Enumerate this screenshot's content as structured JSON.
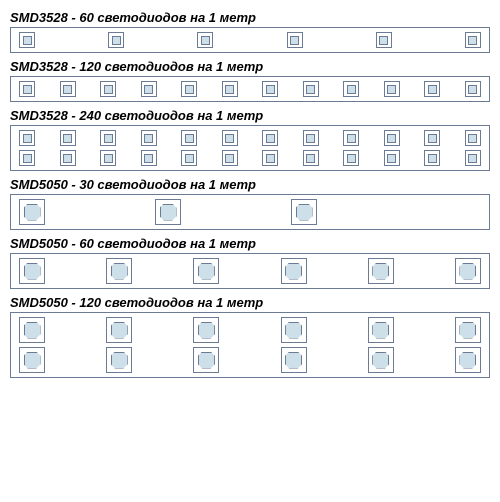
{
  "sections": [
    {
      "label": "SMD3528 - 60 светодиодов на 1 метр",
      "rows": 1,
      "perRow": 6,
      "size": "small",
      "layout": "spread"
    },
    {
      "label": "SMD3528 - 120 светодиодов на 1 метр",
      "rows": 1,
      "perRow": 12,
      "size": "small",
      "layout": "spread"
    },
    {
      "label": "SMD3528 - 240 светодиодов на 1 метр",
      "rows": 2,
      "perRow": 12,
      "size": "small",
      "layout": "spread"
    },
    {
      "label": "SMD5050 - 30 светодиодов на 1 метр",
      "rows": 1,
      "perRow": 3,
      "size": "big",
      "layout": "sparse"
    },
    {
      "label": "SMD5050 - 60 светодиодов на 1 метр",
      "rows": 1,
      "perRow": 6,
      "size": "big",
      "layout": "spread"
    },
    {
      "label": "SMD5050 - 120 светодиодов на 1 метр",
      "rows": 2,
      "perRow": 6,
      "size": "big",
      "layout": "spread"
    }
  ]
}
